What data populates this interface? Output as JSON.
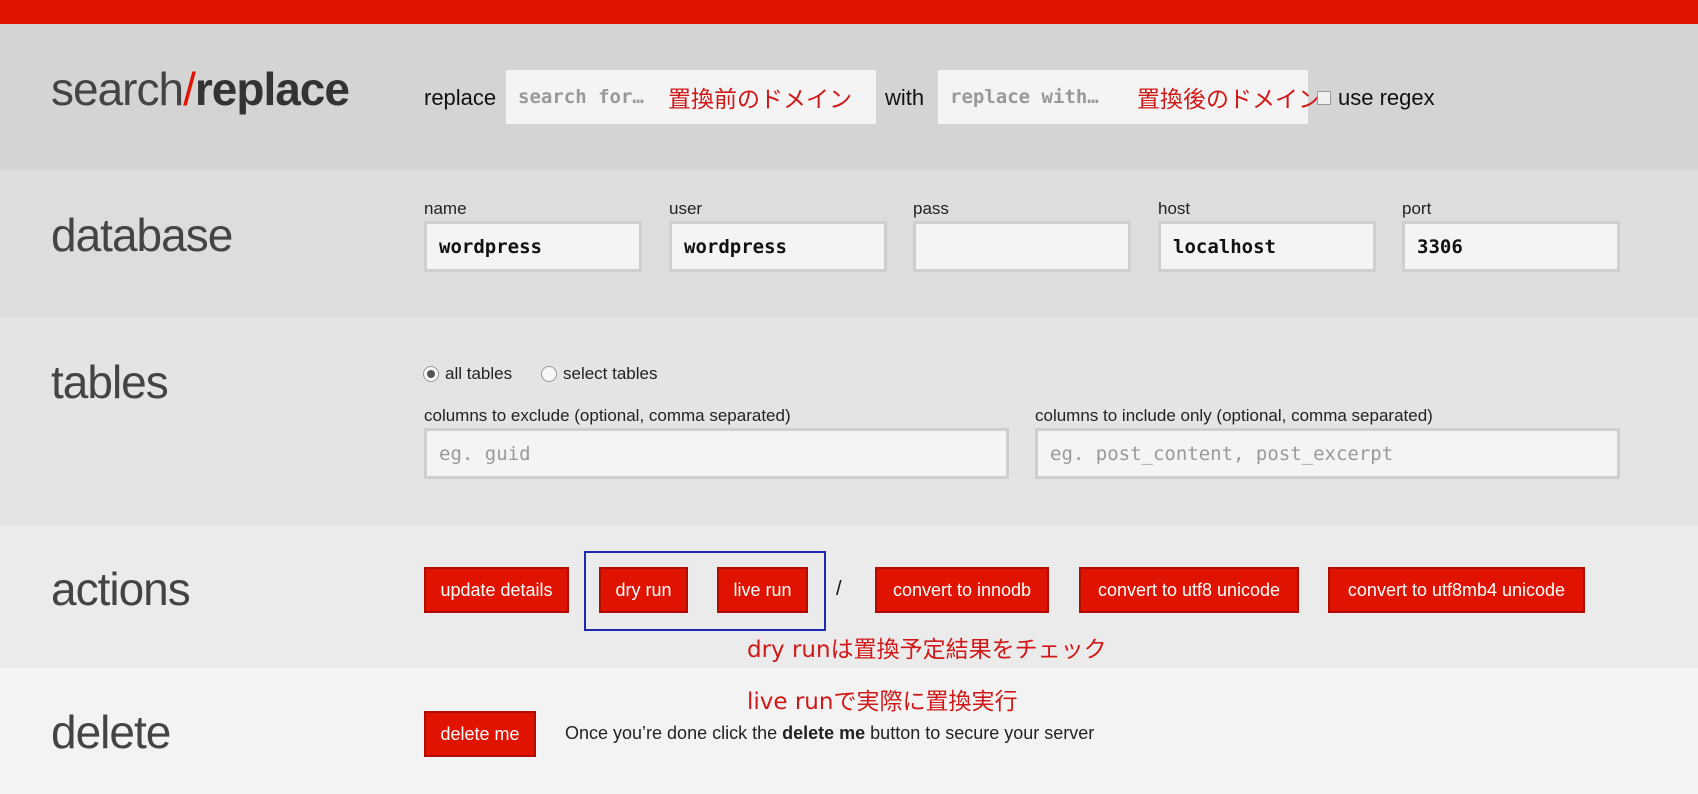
{
  "brand": {
    "search": "search",
    "slash": "/",
    "replace": "replace"
  },
  "replace_row": {
    "replace_label": "replace",
    "search_placeholder": "search for…",
    "search_annotation": "置換前のドメイン",
    "with_label": "with",
    "replace_placeholder": "replace with…",
    "replace_annotation": "置換後のドメイン",
    "regex_label": "use regex"
  },
  "database": {
    "title": "database",
    "fields": [
      {
        "label": "name",
        "value": "wordpress"
      },
      {
        "label": "user",
        "value": "wordpress"
      },
      {
        "label": "pass",
        "value": ""
      },
      {
        "label": "host",
        "value": "localhost"
      },
      {
        "label": "port",
        "value": "3306"
      }
    ]
  },
  "tables": {
    "title": "tables",
    "radio_all": "all tables",
    "radio_select": "select tables",
    "exclude_label": "columns to exclude (optional, comma separated)",
    "exclude_placeholder": "eg. guid",
    "include_label": "columns to include only (optional, comma separated)",
    "include_placeholder": "eg. post_content, post_excerpt"
  },
  "actions": {
    "title": "actions",
    "buttons": {
      "update": "update details",
      "dry": "dry run",
      "live": "live run",
      "separator": "/",
      "innodb": "convert to innodb",
      "utf8": "convert to utf8 unicode",
      "utf8mb4": "convert to utf8mb4 unicode"
    },
    "annotation_dry": "dry runは置換予定結果をチェック",
    "annotation_live": "live runで実際に置換実行"
  },
  "delete": {
    "title": "delete",
    "button": "delete me",
    "text_before": "Once you’re done click the ",
    "text_bold": "delete me",
    "text_after": " button to secure your server"
  },
  "colors": {
    "accent": "#e01200",
    "annotation": "#d01818",
    "highlight": "#1a2ab0"
  }
}
